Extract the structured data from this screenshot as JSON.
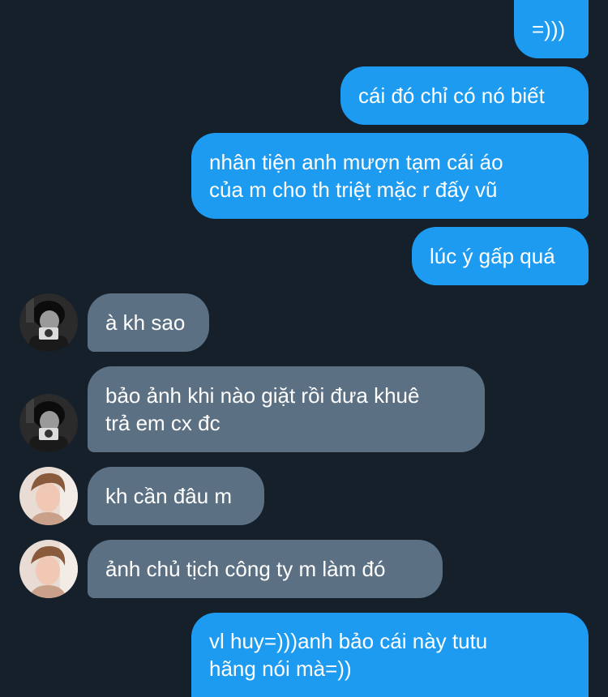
{
  "messages": [
    {
      "direction": "sent",
      "text": "=)))"
    },
    {
      "direction": "sent",
      "text": "cái đó chỉ có nó biết"
    },
    {
      "direction": "sent",
      "text": "nhân tiện anh mượn tạm cái áo\ncủa m cho th triệt mặc r đấy vũ"
    },
    {
      "direction": "sent",
      "text": "lúc ý gấp quá"
    },
    {
      "direction": "received",
      "text": "à kh sao",
      "avatar": "avatar-monochrome-camera"
    },
    {
      "direction": "received",
      "text": "bảo ảnh khi nào giặt rồi đưa khuê\ntrả em cx đc",
      "avatar": "avatar-monochrome-camera"
    },
    {
      "direction": "received",
      "text": "kh cần đâu m",
      "avatar": "avatar-portrait-warm"
    },
    {
      "direction": "received",
      "text": "ảnh chủ tịch công ty m làm đó",
      "avatar": "avatar-portrait-warm"
    },
    {
      "direction": "sent",
      "text": "vl huy=)))anh bảo cái này tutu\nhãng nói mà=))"
    }
  ],
  "colors": {
    "background": "#15202b",
    "sent_bubble": "#1d9bf0",
    "received_bubble": "#5b7083",
    "text": "#ffffff"
  }
}
